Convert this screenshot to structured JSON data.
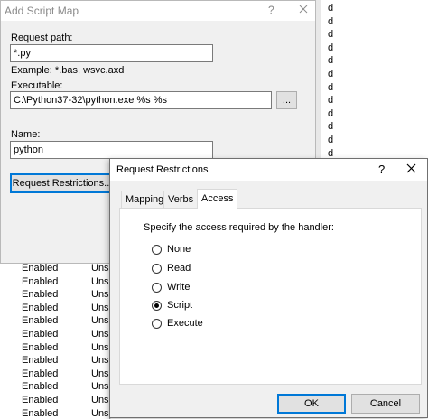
{
  "background_list": {
    "rows": [
      {
        "state": "Enabled",
        "type": "Unsp"
      },
      {
        "state": "Enabled",
        "type": "Unsp"
      },
      {
        "state": "Enabled",
        "type": "Unsp"
      },
      {
        "state": "Enabled",
        "type": "Unsp"
      },
      {
        "state": "Enabled",
        "type": "Unsp"
      },
      {
        "state": "Enabled",
        "type": "Unsp"
      },
      {
        "state": "Enabled",
        "type": "Unsp"
      },
      {
        "state": "Enabled",
        "type": "Unsp"
      },
      {
        "state": "Enabled",
        "type": "Unsp"
      },
      {
        "state": "Enabled",
        "type": "Unsp"
      },
      {
        "state": "Enabled",
        "type": "Unsp"
      },
      {
        "state": "Enabled",
        "type": "Unsp"
      }
    ],
    "right_column_char": "d"
  },
  "add_script_map": {
    "title": "Add Script Map",
    "help": "?",
    "request_path_label": "Request path:",
    "request_path_value": "*.py",
    "example_text": "Example: *.bas, wsvc.axd",
    "executable_label": "Executable:",
    "executable_value": "C:\\Python37-32\\python.exe %s %s",
    "browse_label": "...",
    "name_label": "Name:",
    "name_value": "python",
    "request_restrictions_label": "Request Restrictions..."
  },
  "request_restrictions": {
    "title": "Request Restrictions",
    "help": "?",
    "close": "✕",
    "tabs": [
      {
        "label": "Mapping"
      },
      {
        "label": "Verbs"
      },
      {
        "label": "Access"
      }
    ],
    "prompt": "Specify the access required by the handler:",
    "options": [
      {
        "label": "None",
        "checked": false
      },
      {
        "label": "Read",
        "checked": false
      },
      {
        "label": "Write",
        "checked": false
      },
      {
        "label": "Script",
        "checked": true
      },
      {
        "label": "Execute",
        "checked": false
      }
    ],
    "ok_label": "OK",
    "cancel_label": "Cancel"
  }
}
